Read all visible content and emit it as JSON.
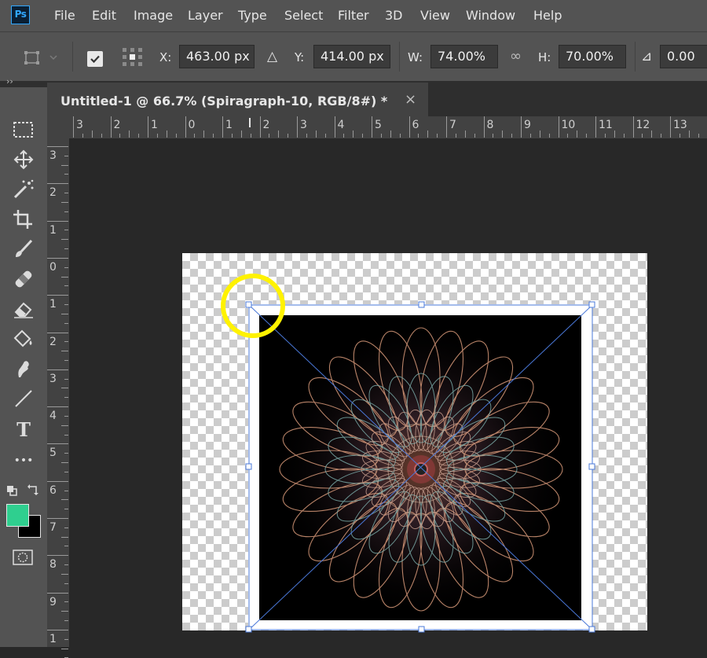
{
  "app": {
    "logo": "Ps"
  },
  "menu": [
    "File",
    "Edit",
    "Image",
    "Layer",
    "Type",
    "Select",
    "Filter",
    "3D",
    "View",
    "Window",
    "Help"
  ],
  "options": {
    "x_label": "X:",
    "x_value": "463.00 px",
    "delta_icon": "△",
    "y_label": "Y:",
    "y_value": "414.00 px",
    "w_label": "W:",
    "w_value": "74.00%",
    "link_icon": "∞",
    "h_label": "H:",
    "h_value": "70.00%",
    "angle_icon": "⊿",
    "angle_value": "0.00"
  },
  "panel_expand": "››",
  "document": {
    "tab_title": "Untitled-1 @ 66.7% (Spiragraph-10, RGB/8#) *",
    "close_label": "×"
  },
  "rulers": {
    "horizontal": [
      "3",
      "2",
      "1",
      "0",
      "1",
      "2",
      "3",
      "4",
      "5",
      "6",
      "7",
      "8",
      "9",
      "10",
      "11",
      "12",
      "13"
    ],
    "vertical": [
      "3",
      "2",
      "1",
      "0",
      "1",
      "2",
      "3",
      "4",
      "5",
      "6",
      "7",
      "8",
      "9",
      "1"
    ]
  },
  "tools": [
    "marquee-tool",
    "move-tool",
    "magic-wand-tool",
    "crop-tool",
    "brush-tool",
    "healing-tool",
    "eraser-tool",
    "paint-bucket-tool",
    "smudge-tool",
    "line-tool",
    "type-tool",
    "more-tools"
  ],
  "type_tool_glyph": "T",
  "more_tools_glyph": "•••",
  "colors": {
    "foreground": "#2fcf8f",
    "background": "#000000",
    "accent": "#31a8ff",
    "highlight": "#fff200",
    "transform_box": "#4a78d8"
  },
  "overlay": {
    "highlight_circle": "yellow-circle-annotation"
  }
}
